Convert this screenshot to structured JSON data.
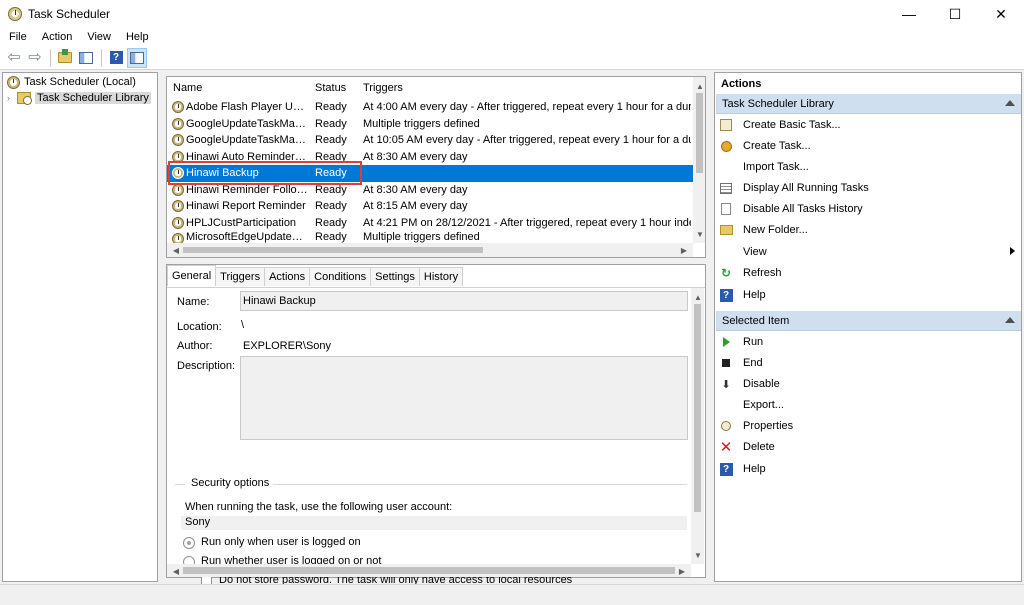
{
  "window": {
    "title": "Task Scheduler",
    "minimize": "—",
    "maximize": "☐",
    "close": "✕"
  },
  "menu": [
    "File",
    "Action",
    "View",
    "Help"
  ],
  "toolbar": {
    "help_label": "?"
  },
  "tree": {
    "root": "Task Scheduler (Local)",
    "child": "Task Scheduler Library"
  },
  "tasklist": {
    "columns": [
      "Name",
      "Status",
      "Triggers"
    ],
    "rows": [
      {
        "name": "Adobe Flash Player Upda...",
        "status": "Ready",
        "triggers": "At 4:00 AM every day - After triggered, repeat every 1 hour for a duratio"
      },
      {
        "name": "GoogleUpdateTaskMachi...",
        "status": "Ready",
        "triggers": "Multiple triggers defined"
      },
      {
        "name": "GoogleUpdateTaskMachi...",
        "status": "Ready",
        "triggers": "At 10:05 AM every day - After triggered, repeat every 1 hour for a duratic"
      },
      {
        "name": "Hinawi Auto Reminder t...",
        "status": "Ready",
        "triggers": "At 8:30 AM every day"
      },
      {
        "name": "Hinawi Backup",
        "status": "Ready",
        "triggers": ""
      },
      {
        "name": "Hinawi Reminder Follow...",
        "status": "Ready",
        "triggers": "At 8:30 AM every day"
      },
      {
        "name": "Hinawi Report Reminder",
        "status": "Ready",
        "triggers": "At 8:15 AM every day"
      },
      {
        "name": "HPLJCustParticipation",
        "status": "Ready",
        "triggers": "At 4:21 PM on 28/12/2021 - After triggered, repeat every 1 hour indefinit"
      },
      {
        "name": "MicrosoftEdgeUpdateTas...",
        "status": "Ready",
        "triggers": "Multiple triggers defined"
      }
    ]
  },
  "details": {
    "tabs": [
      "General",
      "Triggers",
      "Actions",
      "Conditions",
      "Settings",
      "History"
    ],
    "name_label": "Name:",
    "name_value": "Hinawi Backup",
    "location_label": "Location:",
    "location_value": "\\",
    "author_label": "Author:",
    "author_value": "EXPLORER\\Sony",
    "description_label": "Description:",
    "security_title": "Security options",
    "user_account_text": "When running the task, use the following user account:",
    "user_account_value": "Sony",
    "radio_logged_on": "Run only when user is logged on",
    "radio_whether": "Run whether user is logged on or not",
    "checkbox_store": "Do not store password.  The task will only have access to local resources"
  },
  "actions": {
    "title": "Actions",
    "section1": "Task Scheduler Library",
    "items1": [
      "Create Basic Task...",
      "Create Task...",
      "Import Task...",
      "Display All Running Tasks",
      "Disable All Tasks History",
      "New Folder...",
      "View",
      "Refresh",
      "Help"
    ],
    "section2": "Selected Item",
    "items2": [
      "Run",
      "End",
      "Disable",
      "Export...",
      "Properties",
      "Delete",
      "Help"
    ]
  }
}
